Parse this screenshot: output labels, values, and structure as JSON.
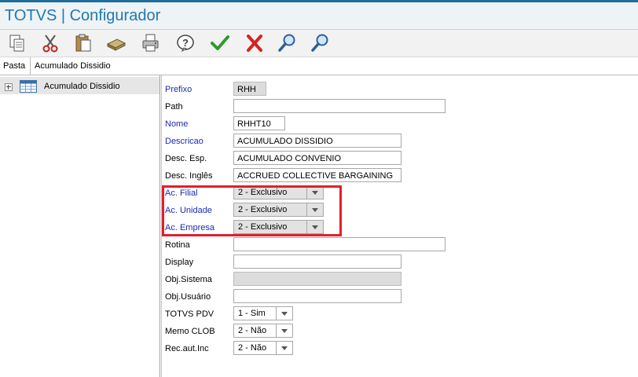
{
  "app": {
    "title": "TOTVS | Configurador"
  },
  "toolbar": {
    "buttons": [
      {
        "icon": "copy-icon"
      },
      {
        "icon": "cut-icon"
      },
      {
        "icon": "paste-icon"
      },
      {
        "icon": "database-icon"
      },
      {
        "icon": "print-icon"
      },
      {
        "icon": "help-icon"
      },
      {
        "icon": "confirm-icon",
        "color": "#2e9a2e"
      },
      {
        "icon": "cancel-icon",
        "color": "#d42323"
      },
      {
        "icon": "search-icon"
      },
      {
        "icon": "search-icon"
      }
    ]
  },
  "pathbar": {
    "label": "Pasta",
    "value": "Acumulado Dissidio"
  },
  "tree": {
    "items": [
      {
        "label": "Acumulado Dissidio",
        "icon": "table-icon"
      }
    ]
  },
  "form": {
    "prefixo": {
      "label": "Prefixo",
      "value": "RHH"
    },
    "path": {
      "label": "Path",
      "value": ""
    },
    "nome": {
      "label": "Nome",
      "value": "RHHT10"
    },
    "descricao": {
      "label": "Descricao",
      "value": "ACUMULADO DISSIDIO"
    },
    "desc_esp": {
      "label": "Desc. Esp.",
      "value": "ACUMULADO CONVENIO"
    },
    "desc_ingles": {
      "label": "Desc. Inglês",
      "value": "ACCRUED COLLECTIVE BARGAINING"
    },
    "ac_filial": {
      "label": "Ac. Filial",
      "value": "2 - Exclusivo"
    },
    "ac_unidade": {
      "label": "Ac. Unidade",
      "value": "2 - Exclusivo"
    },
    "ac_empresa": {
      "label": "Ac. Empresa",
      "value": "2 - Exclusivo"
    },
    "rotina": {
      "label": "Rotina",
      "value": ""
    },
    "display": {
      "label": "Display",
      "value": ""
    },
    "obj_sistema": {
      "label": "Obj.Sistema",
      "value": ""
    },
    "obj_usuario": {
      "label": "Obj.Usuário",
      "value": ""
    },
    "totvs_pdv": {
      "label": "TOTVS PDV",
      "value": "1 - Sim"
    },
    "memo_clob": {
      "label": "Memo CLOB",
      "value": "2 - Não"
    },
    "rec_aut_inc": {
      "label": "Rec.aut.Inc",
      "value": "2 - Não"
    }
  },
  "colors": {
    "highlight": "#e0202e",
    "title": "#1f79b0",
    "required_label": "#1a2bb2"
  }
}
